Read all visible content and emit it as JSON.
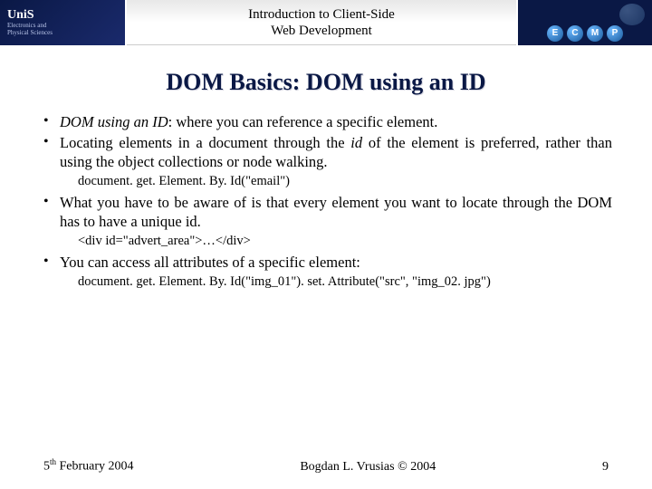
{
  "header": {
    "logo_text": "UniS",
    "dept_line1": "Electronics and",
    "dept_line2": "Physical Sciences",
    "title_line1": "Introduction to Client-Side",
    "title_line2": "Web Development",
    "badges": [
      "E",
      "C",
      "M",
      "P"
    ]
  },
  "slide_title": "DOM Basics: DOM using an ID",
  "bullets": {
    "b1_term": "DOM using an ID",
    "b1_rest": ": where you can reference a specific element.",
    "b2_a": "Locating elements in a document through the ",
    "b2_id": "id",
    "b2_b": " of the element is preferred, rather than using the object collections or node walking.",
    "code1": "document. get. Element. By. Id(\"email\")",
    "b3": "What you have to be aware of is that every element you want to locate through the DOM has to have a unique id.",
    "code2": "<div id=\"advert_area\">…</div>",
    "b4": "You can access all attributes of a specific element:",
    "code3": "document. get. Element. By. Id(\"img_01\"). set. Attribute(\"src\", \"img_02. jpg\")"
  },
  "footer": {
    "date_day": "5",
    "date_suffix": "th",
    "date_rest": " February 2004",
    "author": "Bogdan L. Vrusias © 2004",
    "page": "9"
  }
}
